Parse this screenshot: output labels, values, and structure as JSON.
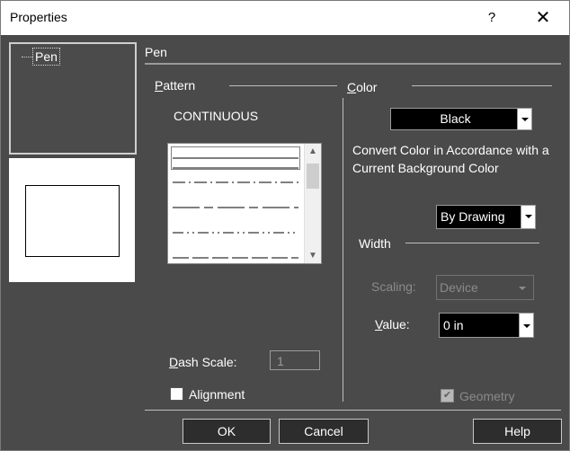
{
  "window": {
    "title": "Properties",
    "help_label": "?",
    "close_label": "✕"
  },
  "tree": {
    "items": [
      {
        "label": "Pen"
      }
    ]
  },
  "section": {
    "title": "Pen"
  },
  "pattern": {
    "group_label": "Pattern",
    "selected": "CONTINUOUS",
    "scroll_up": "▲",
    "scroll_down": "▼",
    "dash_scale_label": "Dash Scale:",
    "dash_scale_value": "1",
    "alignment_label": "Alignment",
    "alignment_checked": false
  },
  "color": {
    "group_label": "Color",
    "selected": "Black",
    "convert_text": "Convert Color in Accordance with a Current Background Color",
    "mode": "By Drawing"
  },
  "width": {
    "group_label": "Width",
    "scaling_label": "Scaling:",
    "scaling_value": "Device",
    "value_label": "Value:",
    "value": "0 in",
    "geometry_label": "Geometry",
    "geometry_checked": true,
    "geometry_check": "✔"
  },
  "footer": {
    "ok": "OK",
    "cancel": "Cancel",
    "help": "Help"
  },
  "colors": {
    "dialog_bg": "#4a4a4a",
    "title_bg": "#ffffff",
    "button_bg": "#2d2d2d"
  },
  "icons": [
    "help-icon",
    "close-icon",
    "chevron-down-icon",
    "chevron-up-icon",
    "checkmark-icon"
  ]
}
